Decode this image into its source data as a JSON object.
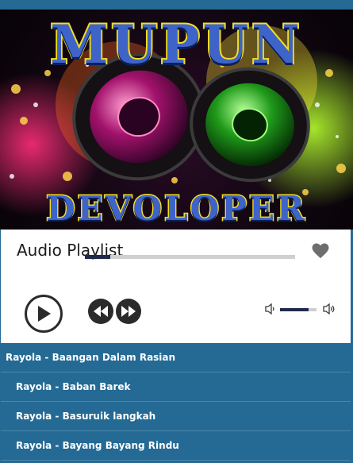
{
  "banner": {
    "title": "MUPUN",
    "subtitle": "DEVOLOPER"
  },
  "player": {
    "playlist_title": "Audio Playlist",
    "seek_progress": 0.12,
    "volume_level": 0.78,
    "icons": {
      "favorite": "heart-icon",
      "play": "play-icon",
      "previous": "rewind-icon",
      "next": "fast-forward-icon",
      "volume_down": "volume-low-icon",
      "volume_up": "volume-high-icon"
    }
  },
  "tracks": [
    {
      "title": "Rayola - Baangan Dalam Rasian",
      "current": true
    },
    {
      "title": "Rayola - Baban Barek",
      "current": false
    },
    {
      "title": "Rayola - Basuruik langkah",
      "current": false
    },
    {
      "title": "Rayola - Bayang Bayang Rindu",
      "current": false
    }
  ],
  "colors": {
    "list_background": "#246a94",
    "accent": "#1f2a4a",
    "controls": "#2b2b2b"
  }
}
